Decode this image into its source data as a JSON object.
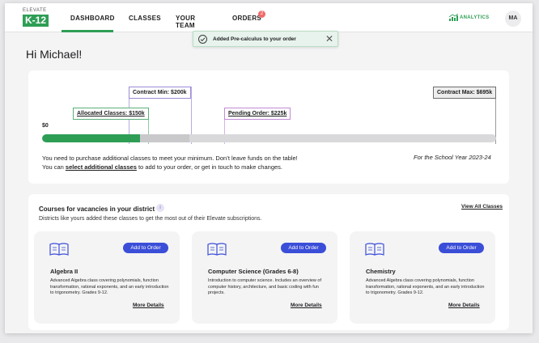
{
  "logo": {
    "top": "ELEVATE",
    "main": "K-12"
  },
  "nav": [
    {
      "label": "DASHBOARD"
    },
    {
      "label": "CLASSES"
    },
    {
      "label": "YOUR TEAM"
    },
    {
      "label": "ORDERS",
      "badge": "2"
    }
  ],
  "analytics_label": "ANALYTICS",
  "avatar_initials": "MA",
  "toast": {
    "message": "Added Pre-calculus to your order"
  },
  "greeting": "Hi Michael!",
  "contract": {
    "min_label": "Contract Min: $200k",
    "max_label": "Contract  Max: $695k",
    "allocated_label": "Allocated Classes: $150k",
    "pending_label": "Pending Order: $225k",
    "zero_label": "$0",
    "allocated_fraction": 0.216,
    "pending_fraction": 0.324,
    "line1": "You need to purchase additional classes to meet your minimum. Don’t leave funds on the table!",
    "line2_pre": "You can ",
    "line2_link": "select additional classes",
    "line2_post": " to add to your order, or get in touch to make changes.",
    "year_note": "For the School Year 2023-24"
  },
  "courses": {
    "title": "Courses for vacancies in your district",
    "info": "i",
    "subtitle": "Districts like yours added these classes to get the most out of their Elevate subscriptions.",
    "view_all": "View All Classes",
    "items": [
      {
        "name": "Algebra II",
        "desc": "Advanced Algebra class covering polynomials, function transformation, rational exponents, and an early introduction to trigonometry. Grades 9-12.",
        "button": "Add to Order",
        "more": "More Details"
      },
      {
        "name": "Computer Science (Grades 6-8)",
        "desc": "Introduction to computer science. Includes an overview of computer history, architecture, and basic coding with fun projects.",
        "button": "Add to Order",
        "more": "More Details"
      },
      {
        "name": "Chemistry",
        "desc": "Advanced Algebra class covering polynomials, function transformation, rational exponents, and an early introduction to trigonometry. Grades 9-12.",
        "button": "Add to Order",
        "more": "More Details"
      }
    ]
  },
  "colors": {
    "brand_green": "#2f9e55",
    "button_blue": "#3b4ed8",
    "badge_red": "#f06a6a"
  }
}
